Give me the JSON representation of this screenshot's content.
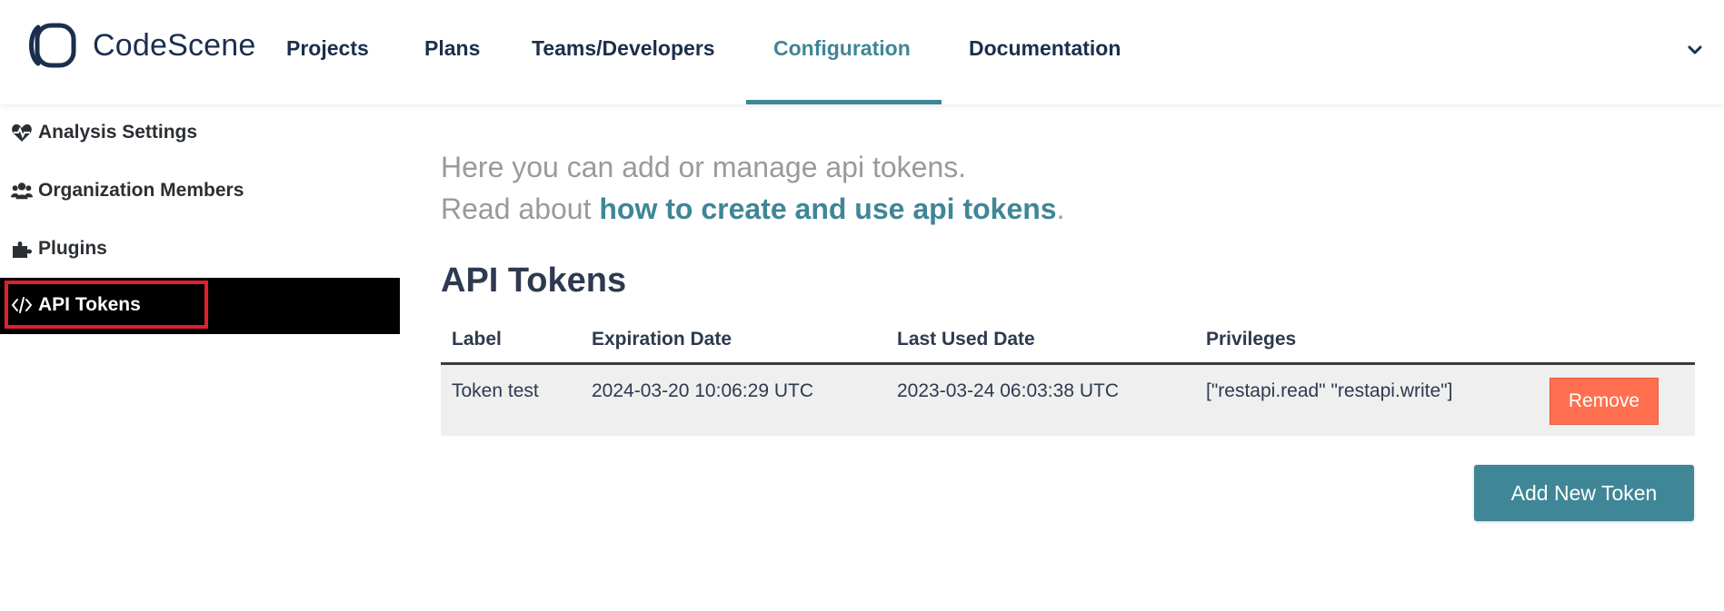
{
  "app": {
    "logo_text": "CodeScene",
    "logo_icon": "codescene-logo-icon"
  },
  "nav": {
    "items": [
      {
        "label": "Projects"
      },
      {
        "label": "Plans"
      },
      {
        "label": "Teams/Developers"
      },
      {
        "label": "Configuration",
        "active": true
      },
      {
        "label": "Documentation"
      }
    ],
    "menu_icon": "chevron-down-icon"
  },
  "sidebar": {
    "items": [
      {
        "label": "Analysis Settings",
        "icon": "heartbeat-icon"
      },
      {
        "label": "Organization Members",
        "icon": "users-icon"
      },
      {
        "label": "Plugins",
        "icon": "puzzle-icon"
      },
      {
        "label": "API Tokens",
        "icon": "code-icon",
        "active": true
      }
    ]
  },
  "main": {
    "intro_line1": "Here you can add or manage api tokens.",
    "intro_line2_prefix": "Read about ",
    "intro_link": "how to create and use api tokens",
    "intro_line2_suffix": ".",
    "section_title": "API Tokens",
    "table": {
      "columns": [
        "Label",
        "Expiration Date",
        "Last Used Date",
        "Privileges"
      ],
      "rows": [
        {
          "label": "Token test",
          "expiration": "2024-03-20 10:06:29 UTC",
          "last_used": "2023-03-24 06:03:38 UTC",
          "privileges": "[\"restapi.read\" \"restapi.write\"]",
          "action": "Remove"
        }
      ]
    },
    "add_button": "Add New Token"
  },
  "colors": {
    "accent": "#3f8696",
    "danger": "#ff6f4f",
    "highlight": "#e0202f",
    "sidebar_active_bg": "#000000"
  }
}
